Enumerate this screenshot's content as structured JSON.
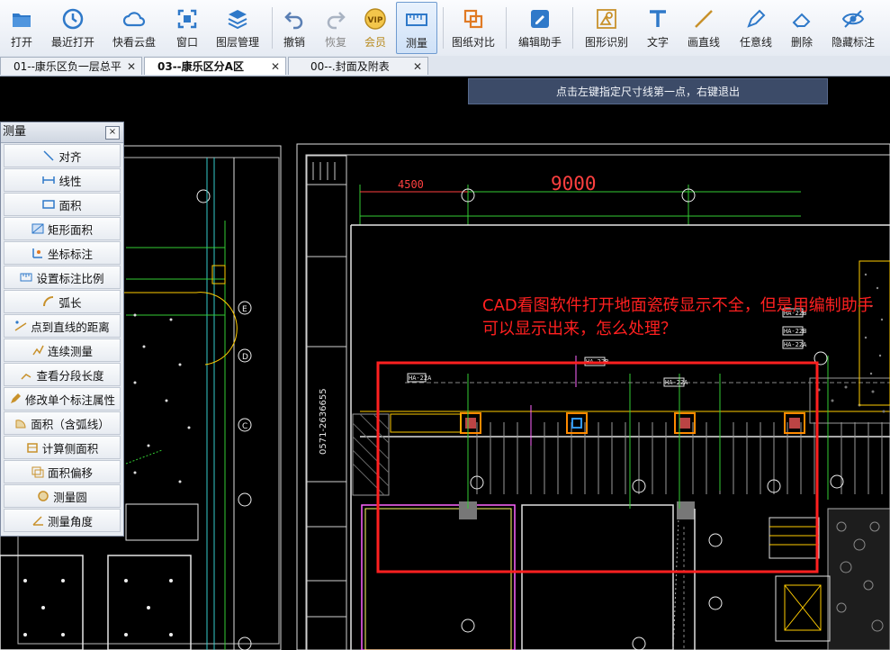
{
  "toolbar": {
    "items": [
      {
        "label": "打开"
      },
      {
        "label": "最近打开"
      },
      {
        "label": "快看云盘"
      },
      {
        "label": "窗口"
      },
      {
        "label": "图层管理"
      },
      {
        "label": "撤销"
      },
      {
        "label": "恢复"
      },
      {
        "label": "会员"
      },
      {
        "label": "测量"
      },
      {
        "label": "图纸对比"
      },
      {
        "label": "编辑助手"
      },
      {
        "label": "图形识别"
      },
      {
        "label": "文字"
      },
      {
        "label": "画直线"
      },
      {
        "label": "任意线"
      },
      {
        "label": "删除"
      },
      {
        "label": "隐藏标注"
      }
    ],
    "vip_badge": "VIP"
  },
  "tabs": [
    {
      "label": "01--康乐区负一层总平"
    },
    {
      "label": "03--康乐区分A区"
    },
    {
      "label": "00--.封面及附表"
    }
  ],
  "hint": "点击左键指定尺寸线第一点，右键退出",
  "annotation": "CAD看图软件打开地面瓷砖显示不全，但是用编制助手可以显示出来，怎么处理？",
  "panel": {
    "title": "测量",
    "close": "×",
    "items": [
      {
        "label": "对齐"
      },
      {
        "label": "线性"
      },
      {
        "label": "面积"
      },
      {
        "label": "矩形面积"
      },
      {
        "label": "坐标标注"
      },
      {
        "label": "设置标注比例"
      },
      {
        "label": "弧长"
      },
      {
        "label": "点到直线的距离"
      },
      {
        "label": "连续测量"
      },
      {
        "label": "查看分段长度"
      },
      {
        "label": "修改单个标注属性"
      },
      {
        "label": "面积（含弧线）"
      },
      {
        "label": "计算侧面积"
      },
      {
        "label": "面积偏移"
      },
      {
        "label": "测量圆"
      },
      {
        "label": "测量角度"
      }
    ]
  },
  "drawing": {
    "dim_small": "4500",
    "dim_large": "9000",
    "phone_text": "0571-2636655",
    "axis_marks": [
      "E",
      "D",
      "C"
    ],
    "tags": [
      "HA-22A",
      "HA-22B",
      "HA-22B",
      "HA-22A",
      "HA-22A",
      "HA-22B"
    ]
  },
  "colors": {
    "accent": "#ff2020",
    "hint_bg": "#3c4b68",
    "toolbar_bg": "#eef2f8"
  }
}
